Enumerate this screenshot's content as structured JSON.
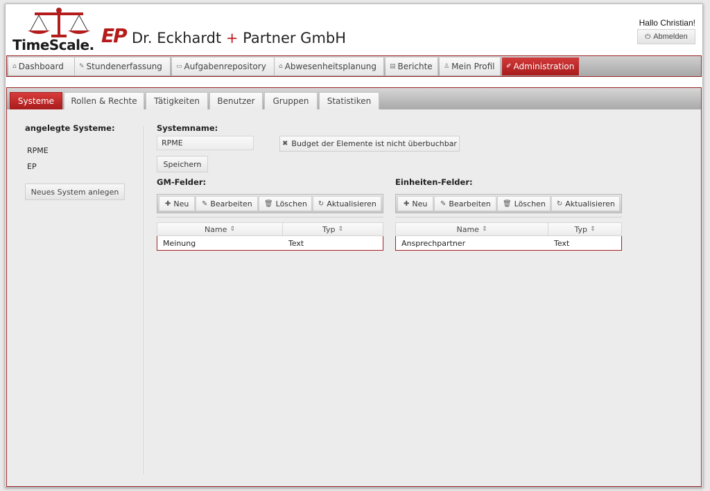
{
  "header": {
    "logo_text": "TimeScale",
    "logo_dot": ".",
    "ep_logo": "EP",
    "company_part1": "Dr. Eckhardt ",
    "company_plus": "+",
    "company_part2": " Partner GmbH",
    "greeting": "Hallo Christian!",
    "logout_label": "Abmelden",
    "logout_icon": "power-icon",
    "accent_color": "#b51b1b"
  },
  "mainnav": {
    "items": [
      {
        "label": "Dashboard",
        "icon": "home-icon"
      },
      {
        "label": "Stundenerfassung",
        "icon": "pencil-icon"
      },
      {
        "label": "Aufgabenrepository",
        "icon": "folder-icon"
      },
      {
        "label": "Abwesenheitsplanung",
        "icon": "house-icon"
      },
      {
        "label": "Berichte",
        "icon": "report-icon"
      },
      {
        "label": "Mein Profil",
        "icon": "user-icon"
      },
      {
        "label": "Administration",
        "icon": "wrench-icon",
        "active": true
      }
    ]
  },
  "subnav": {
    "tabs": [
      {
        "label": "Systeme",
        "active": true
      },
      {
        "label": "Rollen & Rechte"
      },
      {
        "label": "Tätigkeiten"
      },
      {
        "label": "Benutzer"
      },
      {
        "label": "Gruppen"
      },
      {
        "label": "Statistiken"
      }
    ]
  },
  "left": {
    "title": "angelegte Systeme:",
    "systems": [
      "RPME",
      "EP"
    ],
    "new_system_label": "Neues System anlegen"
  },
  "system": {
    "name_label": "Systemname:",
    "name_value": "RPME",
    "budget_label": "Budget der Elemente ist nicht überbuchbar",
    "save_label": "Speichern"
  },
  "toolbar": {
    "new": "Neu",
    "edit": "Bearbeiten",
    "delete": "Löschen",
    "refresh": "Aktualisieren"
  },
  "gm": {
    "title": "GM-Felder:",
    "col_name": "Name",
    "col_type": "Typ",
    "rows": [
      {
        "name": "Meinung",
        "type": "Text"
      }
    ]
  },
  "units": {
    "title": "Einheiten-Felder:",
    "col_name": "Name",
    "col_type": "Typ",
    "rows": [
      {
        "name": "Ansprechpartner",
        "type": "Text"
      }
    ]
  }
}
